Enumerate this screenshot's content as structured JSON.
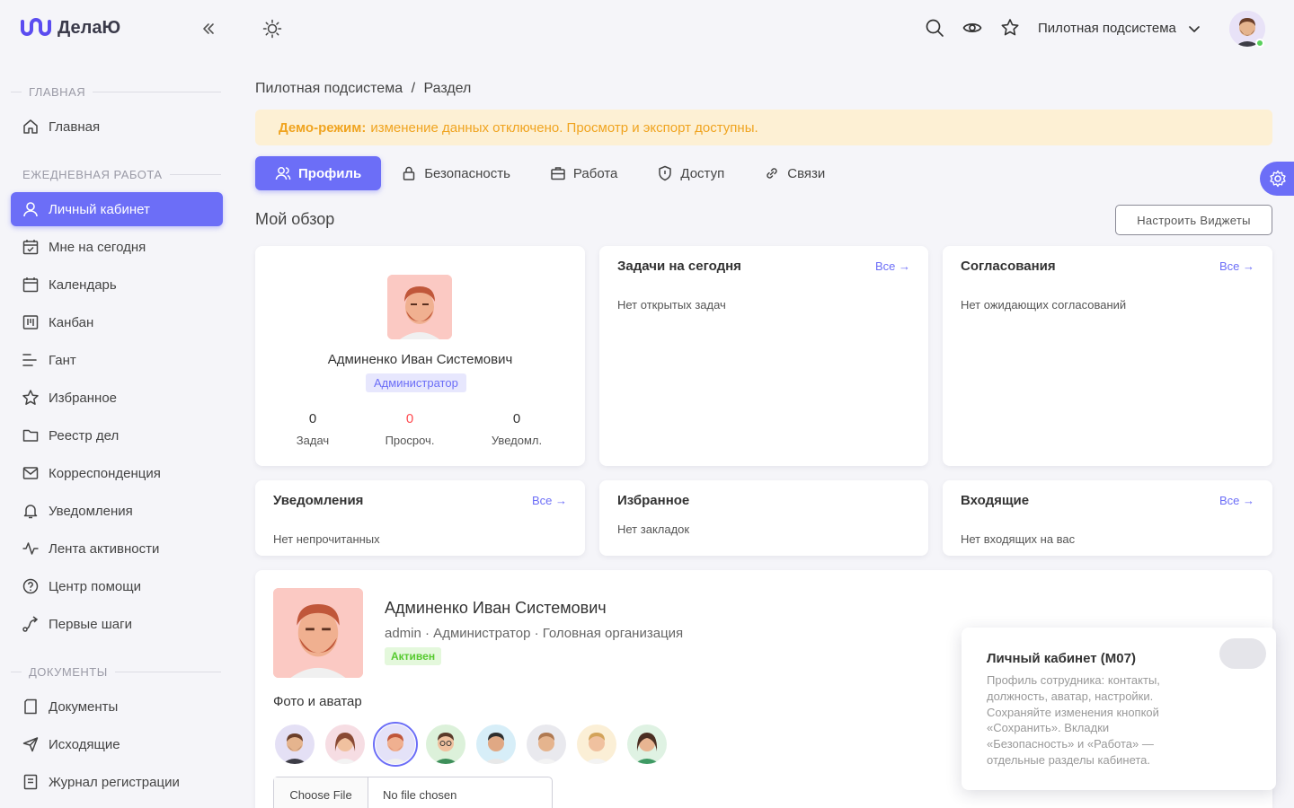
{
  "app": {
    "name": "ДелаЮ"
  },
  "topbar": {
    "subsystem": "Пилотная подсистема"
  },
  "breadcrumb": {
    "root": "Пилотная подсистема",
    "separator": "/",
    "current": "Раздел"
  },
  "banner": {
    "bold": "Демо-режим:",
    "text": "изменение данных отключено. Просмотр и экспорт доступны."
  },
  "sidebar": {
    "sections": {
      "main": "ГЛАВНАЯ",
      "daily": "ЕЖЕДНЕВНАЯ РАБОТА",
      "docs": "ДОКУМЕНТЫ"
    },
    "items": [
      {
        "label": "Главная",
        "icon": "home-icon"
      },
      {
        "label": "Личный кабинет",
        "icon": "user-icon",
        "active": true
      },
      {
        "label": "Мне на сегодня",
        "icon": "calendar-check-icon"
      },
      {
        "label": "Календарь",
        "icon": "calendar-icon"
      },
      {
        "label": "Канбан",
        "icon": "kanban-icon"
      },
      {
        "label": "Гант",
        "icon": "gantt-icon"
      },
      {
        "label": "Избранное",
        "icon": "star-icon"
      },
      {
        "label": "Реестр дел",
        "icon": "folder-icon"
      },
      {
        "label": "Корреспонденция",
        "icon": "mail-icon"
      },
      {
        "label": "Уведомления",
        "icon": "bell-icon"
      },
      {
        "label": "Лента активности",
        "icon": "activity-icon"
      },
      {
        "label": "Центр помощи",
        "icon": "help-circle-icon"
      },
      {
        "label": "Первые шаги",
        "icon": "route-icon"
      },
      {
        "label": "Документы",
        "icon": "document-icon"
      },
      {
        "label": "Исходящие",
        "icon": "send-icon"
      },
      {
        "label": "Журнал регистрации",
        "icon": "journal-icon"
      }
    ]
  },
  "tabs": [
    {
      "label": "Профиль",
      "icon": "users-icon",
      "active": true
    },
    {
      "label": "Безопасность",
      "icon": "lock-icon"
    },
    {
      "label": "Работа",
      "icon": "briefcase-icon"
    },
    {
      "label": "Доступ",
      "icon": "shield-icon"
    },
    {
      "label": "Связи",
      "icon": "link-icon"
    }
  ],
  "overview": {
    "title": "Мой обзор",
    "configure_button": "Настроить Виджеты"
  },
  "profile_card": {
    "name": "Админенко Иван Системович",
    "role": "Администратор",
    "stats": [
      {
        "value": "0",
        "label": "Задач"
      },
      {
        "value": "0",
        "label": "Просроч."
      },
      {
        "value": "0",
        "label": "Уведомл."
      }
    ]
  },
  "widgets": {
    "all_link": "Все →",
    "tasks": {
      "title": "Задачи на сегодня",
      "empty": "Нет открытых задач"
    },
    "approvals": {
      "title": "Согласования",
      "empty": "Нет ожидающих согласований"
    },
    "notifications": {
      "title": "Уведомления",
      "empty": "Нет непрочитанных"
    },
    "favorites": {
      "title": "Избранное",
      "empty": "Нет закладок"
    },
    "incoming": {
      "title": "Входящие",
      "empty": "Нет входящих на вас"
    }
  },
  "details": {
    "name": "Админенко Иван Системович",
    "subtitle": "admin · Администратор · Головная организация",
    "status": "Активен",
    "photo_label": "Фото и аватар",
    "file_button": "Choose File",
    "file_status": "No file chosen"
  },
  "help": {
    "title": "Личный кабинет (М07)",
    "text": "Профиль сотрудника: контакты, должность, аватар, настройки. Сохраняйте изменения кнопкой «Сохранить». Вкладки «Безопасность» и «Работа» — отдельные разделы кабинета."
  },
  "colors": {
    "accent": "#6c6ef7",
    "danger": "#ff4c51",
    "success": "#56ca2f",
    "warning": "#f0a420"
  }
}
